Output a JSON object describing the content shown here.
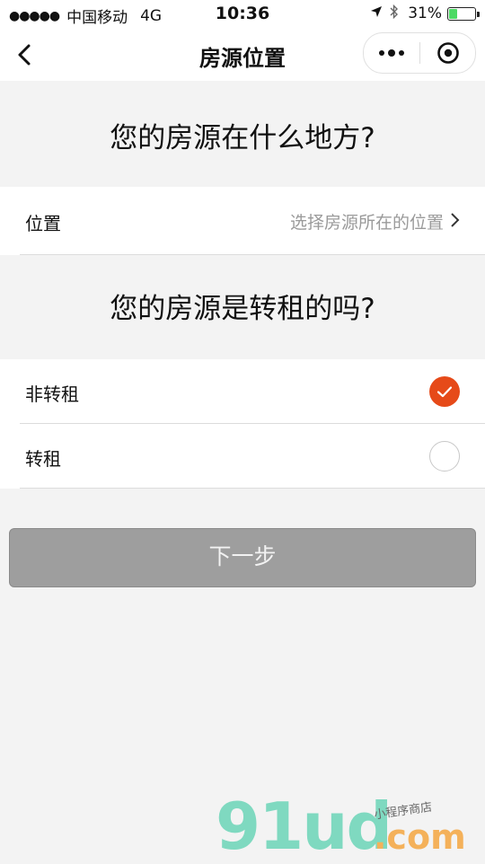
{
  "status_bar": {
    "signal": "●●●●●",
    "carrier": "中国移动",
    "network": "4G",
    "time": "10:36",
    "battery_percent": "31%",
    "battery_level": 0.31,
    "battery_color": "#4cd964"
  },
  "nav": {
    "title": "房源位置",
    "back_icon": "chevron-left-icon",
    "more_icon": "more-dots-icon",
    "close_icon": "record-target-icon"
  },
  "section_location": {
    "question": "您的房源在什么地方?",
    "row_label": "位置",
    "row_placeholder": "选择房源所在的位置"
  },
  "section_sublet": {
    "question": "您的房源是转租的吗?",
    "options": [
      {
        "label": "非转租",
        "selected": true
      },
      {
        "label": "转租",
        "selected": false
      }
    ]
  },
  "next_button": {
    "label": "下一步"
  },
  "colors": {
    "accent": "#e64a19",
    "button_disabled": "#9e9e9e",
    "background": "#f3f3f3"
  },
  "watermark": {
    "main": "91ud",
    "suffix": ".com",
    "tagline": "小程序商店"
  }
}
